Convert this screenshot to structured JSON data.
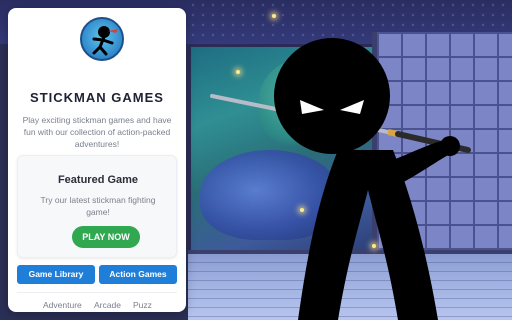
{
  "card": {
    "title": "STICKMAN GAMES",
    "description": "Play exciting stickman games and have fun with our collection of action-packed adventures!",
    "featured": {
      "title": "Featured Game",
      "text": "Try our latest stickman fighting game!",
      "button_label": "PLAY NOW"
    },
    "buttons": {
      "library": "Game Library",
      "action": "Action Games"
    },
    "categories": [
      "Adventure",
      "Arcade",
      "Puzz"
    ]
  },
  "colors": {
    "accent_green": "#2fa84f",
    "accent_blue": "#1f7fd8",
    "title_text": "#1f2235",
    "muted_text": "#7a7f8c"
  },
  "icons": {
    "logo": "stickman-logo-icon"
  }
}
